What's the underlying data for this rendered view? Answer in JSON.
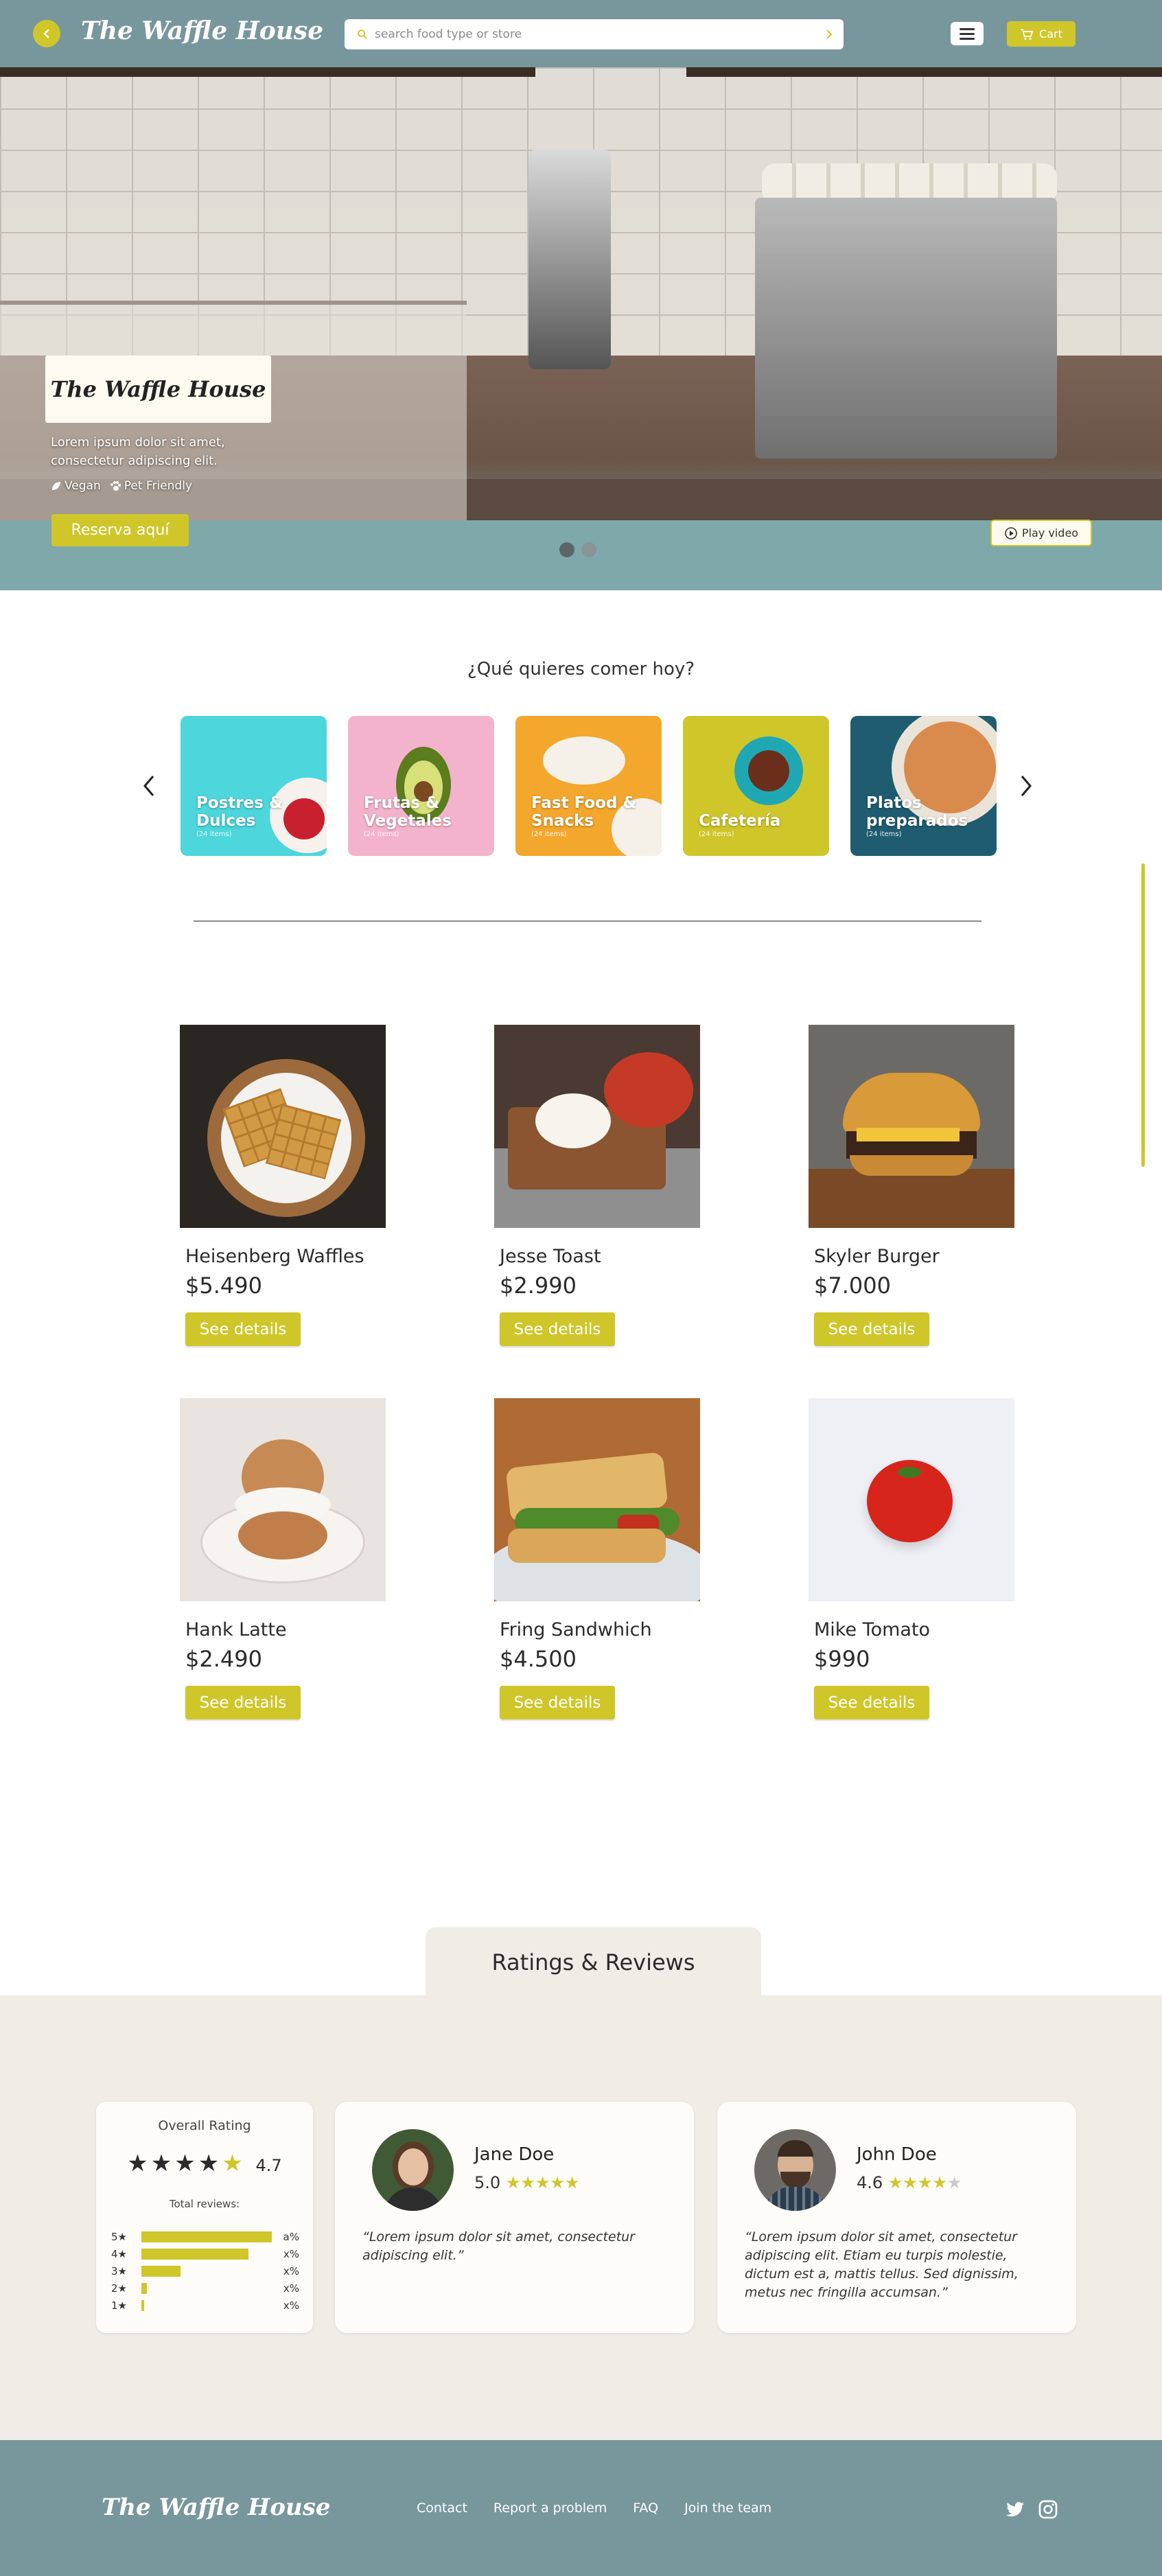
{
  "header": {
    "brand": "The Waffle House",
    "search_placeholder": "search food type or store",
    "cart_label": "Cart"
  },
  "hero": {
    "brand": "The Waffle House",
    "description": "Lorem ipsum dolor sit amet, consectetur adipiscing elit.",
    "tags": [
      "Vegan",
      "Pet Friendly"
    ],
    "reserve_label": "Reserva aquí",
    "play_video_label": "Play video",
    "slides_total": 2,
    "slide_active": 1
  },
  "categories": {
    "title": "¿Qué quieres comer hoy?",
    "items": [
      {
        "name": "Postres & Dulces",
        "count": "(24 items)",
        "color": "#4dd6dc"
      },
      {
        "name": "Frutas & Vegetales",
        "count": "(24 items)",
        "color": "#f4b3cc"
      },
      {
        "name": "Fast Food & Snacks",
        "count": "(24 items)",
        "color": "#f4a72d"
      },
      {
        "name": "Cafetería",
        "count": "(24 items)",
        "color": "#cfc62a"
      },
      {
        "name": "Platos preparados",
        "count": "(24 items)",
        "color": "#1f5c70"
      }
    ]
  },
  "products": [
    {
      "name": "Heisenberg Waffles",
      "price": "$5.490",
      "button": "See details"
    },
    {
      "name": "Jesse Toast",
      "price": "$2.990",
      "button": "See details"
    },
    {
      "name": "Skyler Burger",
      "price": "$7.000",
      "button": "See details"
    },
    {
      "name": "Hank Latte",
      "price": "$2.490",
      "button": "See details"
    },
    {
      "name": "Fring Sandwhich",
      "price": "$4.500",
      "button": "See details"
    },
    {
      "name": "Mike Tomato",
      "price": "$990",
      "button": "See details"
    }
  ],
  "ratings": {
    "section_title": "Ratings & Reviews",
    "overall_title": "Overall Rating",
    "overall_score": "4.7",
    "total_reviews_label": "Total reviews:",
    "distribution": [
      {
        "label": "5★",
        "pct": "a%",
        "fraction": 1.0
      },
      {
        "label": "4★",
        "pct": "x%",
        "fraction": 0.82
      },
      {
        "label": "3★",
        "pct": "x%",
        "fraction": 0.3
      },
      {
        "label": "2★",
        "pct": "x%",
        "fraction": 0.04
      },
      {
        "label": "1★",
        "pct": "x%",
        "fraction": 0.02
      }
    ],
    "reviews": [
      {
        "name": "Jane Doe",
        "score": "5.0",
        "stars": 5,
        "text": "“Lorem ipsum dolor sit amet, consectetur adipiscing elit.”"
      },
      {
        "name": "John Doe",
        "score": "4.6",
        "stars": 4,
        "text": "“Lorem ipsum dolor sit amet, consectetur adipiscing elit. Etiam eu turpis molestie, dictum est a, mattis tellus. Sed dignissim, metus nec fringilla accumsan.”"
      }
    ]
  },
  "footer": {
    "brand": "The Waffle House",
    "links": [
      "Contact",
      "Report a problem",
      "FAQ",
      "Join the team"
    ]
  },
  "colors": {
    "accent": "#cfc62a",
    "header_bg": "#78979d",
    "reviews_bg": "#f0ece6"
  }
}
